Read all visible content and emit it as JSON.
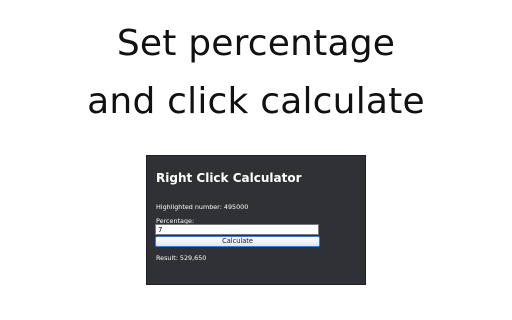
{
  "headline": {
    "line1": "Set percentage",
    "line2": "and click calculate"
  },
  "popup": {
    "title": "Right Click Calculator",
    "highlighted_label": "Highlighted number: 495000",
    "percentage_label": "Percentage:",
    "percentage_value": "7",
    "calculate_label": "Calculate",
    "result_text": "Result: 529,650"
  }
}
